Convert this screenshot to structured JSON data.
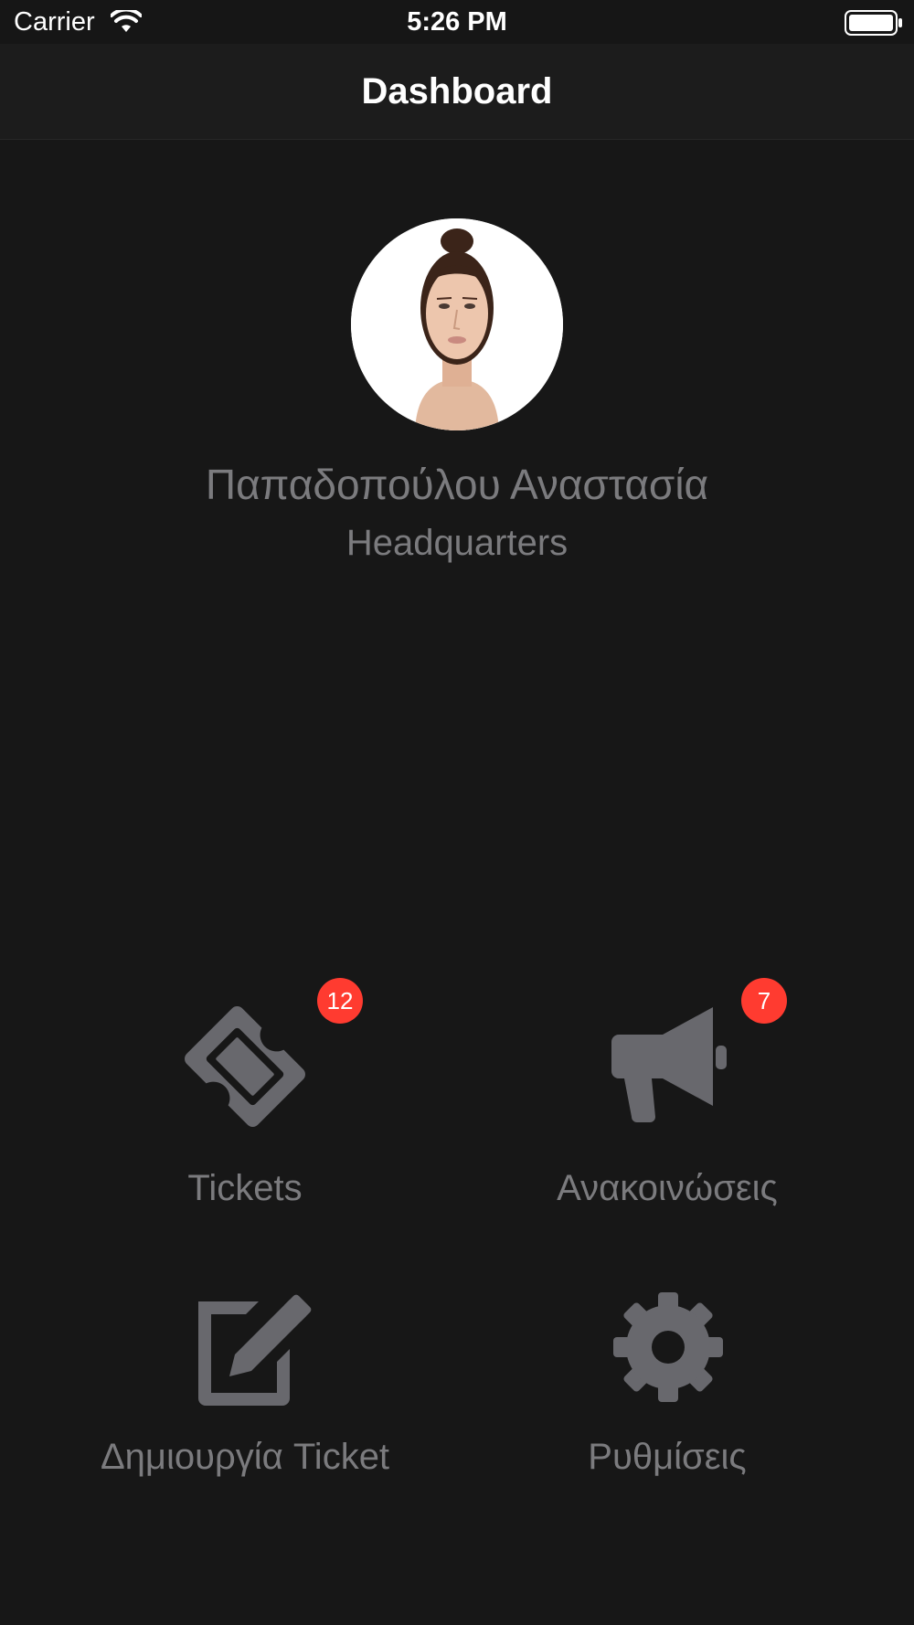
{
  "status_bar": {
    "carrier": "Carrier",
    "time": "5:26 PM"
  },
  "nav": {
    "title": "Dashboard"
  },
  "profile": {
    "name": "Παπαδοπούλου Αναστασία",
    "subtitle": "Headquarters"
  },
  "menu": [
    {
      "label": "Tickets",
      "icon": "ticket-icon",
      "badge": "12"
    },
    {
      "label": "Ανακοινώσεις",
      "icon": "megaphone-icon",
      "badge": "7"
    },
    {
      "label": "Δημιουργία Ticket",
      "icon": "edit-icon"
    },
    {
      "label": "Ρυθμίσεις",
      "icon": "gear-icon"
    }
  ],
  "colors": {
    "background": "#171717",
    "icon_gray": "#68686d",
    "label_gray": "#7b7b7e",
    "badge_red": "#ff3b30"
  }
}
